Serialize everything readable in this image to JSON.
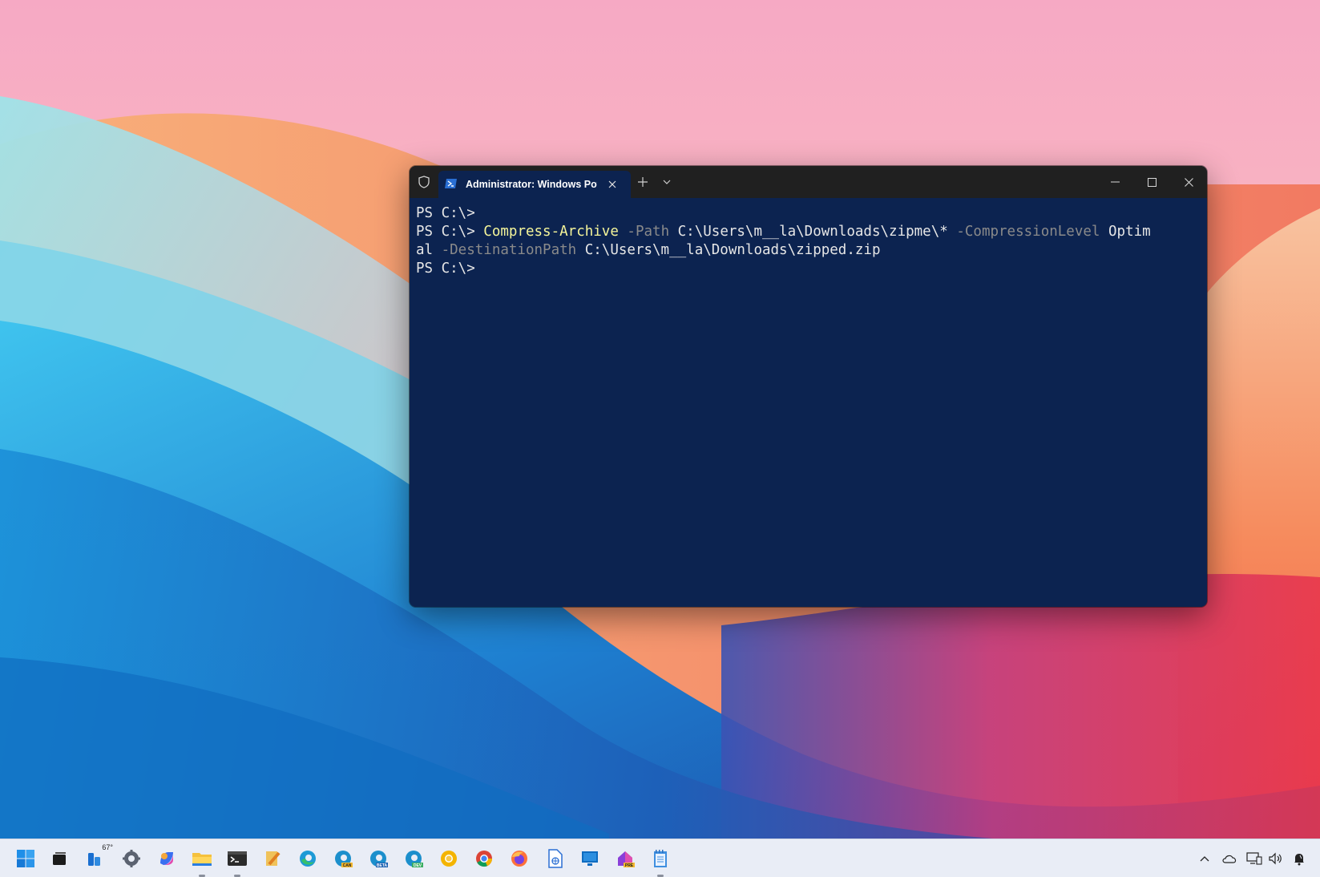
{
  "terminal": {
    "tab_title": "Administrator: Windows Powe",
    "lines": [
      {
        "prompt": "PS C:\\> ",
        "segments": []
      },
      {
        "prompt": "PS C:\\> ",
        "segments": [
          {
            "cls": "cmd",
            "text": "Compress-Archive"
          },
          {
            "cls": "txt",
            "text": " "
          },
          {
            "cls": "param",
            "text": "-Path"
          },
          {
            "cls": "txt",
            "text": " C:\\Users\\m__la\\Downloads\\zipme\\* "
          },
          {
            "cls": "param",
            "text": "-CompressionLevel"
          },
          {
            "cls": "txt",
            "text": " Optim"
          }
        ]
      },
      {
        "prompt": "",
        "segments": [
          {
            "cls": "txt",
            "text": "al "
          },
          {
            "cls": "param",
            "text": "-DestinationPath"
          },
          {
            "cls": "txt",
            "text": " C:\\Users\\m__la\\Downloads\\zipped.zip"
          }
        ]
      },
      {
        "prompt": "PS C:\\> ",
        "segments": []
      }
    ]
  },
  "taskbar": {
    "weather_temp": "67°",
    "apps": [
      {
        "name": "start-icon"
      },
      {
        "name": "task-view-icon"
      },
      {
        "name": "widgets-weather-icon"
      },
      {
        "name": "settings-icon"
      },
      {
        "name": "copilot-icon"
      },
      {
        "name": "file-explorer-icon"
      },
      {
        "name": "terminal-icon"
      },
      {
        "name": "notepad-plus-icon"
      },
      {
        "name": "edge-icon"
      },
      {
        "name": "edge-canary-icon",
        "badge": "CAN"
      },
      {
        "name": "edge-beta-icon",
        "badge": "BETA"
      },
      {
        "name": "edge-dev-icon",
        "badge": "DEV"
      },
      {
        "name": "chrome-canary-icon"
      },
      {
        "name": "chrome-icon"
      },
      {
        "name": "firefox-icon"
      },
      {
        "name": "word-document-icon"
      },
      {
        "name": "remote-desktop-icon"
      },
      {
        "name": "dev-home-icon",
        "badge": "PRE"
      },
      {
        "name": "notepad-icon"
      }
    ],
    "tray": [
      "chevron-up-icon",
      "onedrive-icon",
      "network-icon",
      "volume-icon",
      "notification-bell-icon"
    ]
  },
  "colors": {
    "console_bg": "#0c2350",
    "command": "#f5f59a",
    "parameter": "#8a8a8a",
    "text": "#e6e6e6",
    "titlebar": "#202020"
  }
}
